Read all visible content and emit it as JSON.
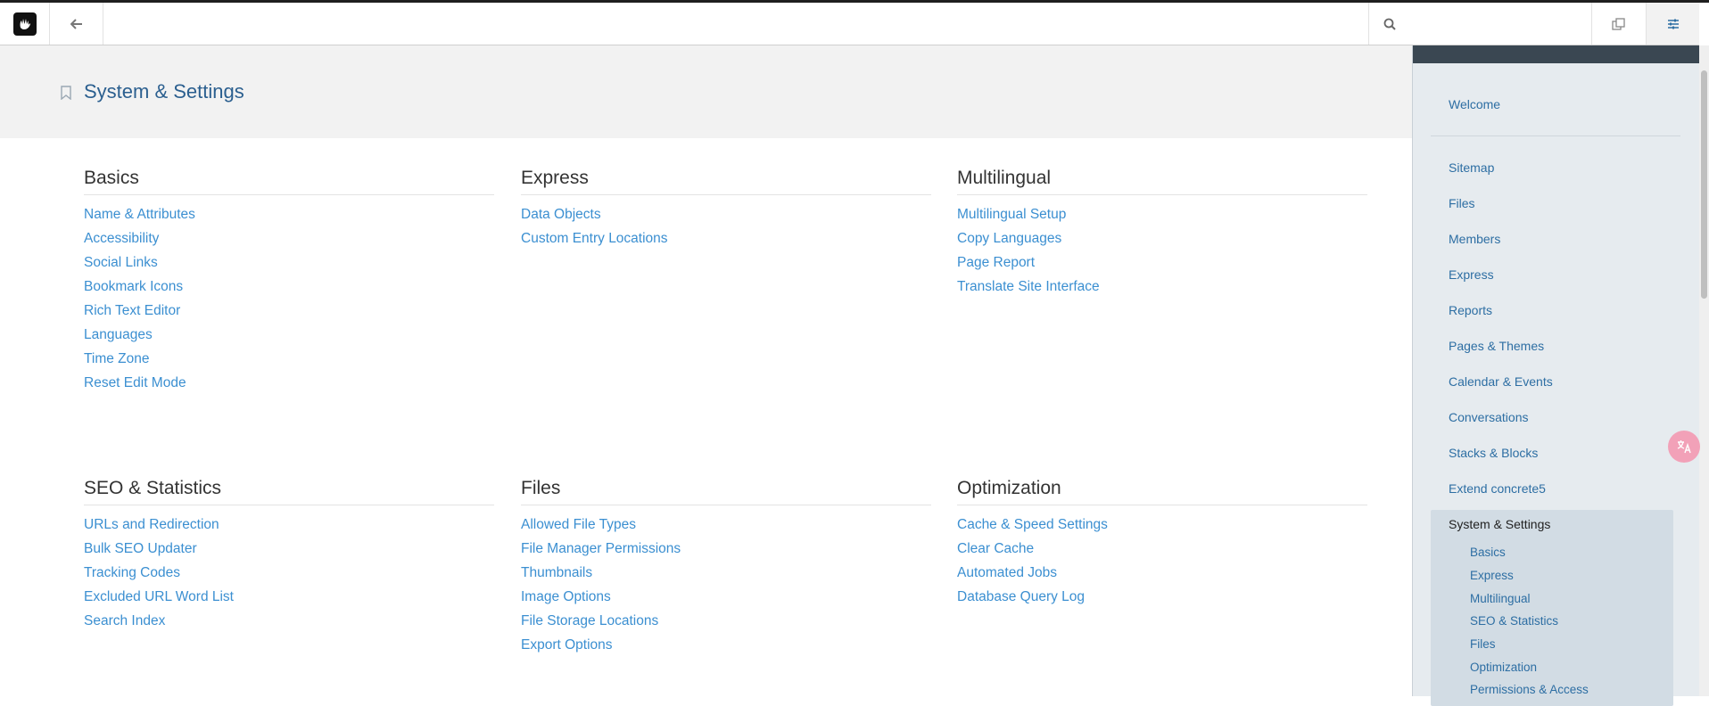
{
  "header": {
    "title": "System & Settings"
  },
  "search": {
    "placeholder": ""
  },
  "sections": [
    {
      "title": "Basics",
      "links": [
        "Name & Attributes",
        "Accessibility",
        "Social Links",
        "Bookmark Icons",
        "Rich Text Editor",
        "Languages",
        "Time Zone",
        "Reset Edit Mode"
      ]
    },
    {
      "title": "Express",
      "links": [
        "Data Objects",
        "Custom Entry Locations"
      ]
    },
    {
      "title": "Multilingual",
      "links": [
        "Multilingual Setup",
        "Copy Languages",
        "Page Report",
        "Translate Site Interface"
      ]
    },
    {
      "title": "SEO & Statistics",
      "links": [
        "URLs and Redirection",
        "Bulk SEO Updater",
        "Tracking Codes",
        "Excluded URL Word List",
        "Search Index"
      ]
    },
    {
      "title": "Files",
      "links": [
        "Allowed File Types",
        "File Manager Permissions",
        "Thumbnails",
        "Image Options",
        "File Storage Locations",
        "Export Options"
      ]
    },
    {
      "title": "Optimization",
      "links": [
        "Cache & Speed Settings",
        "Clear Cache",
        "Automated Jobs",
        "Database Query Log"
      ]
    }
  ],
  "sidebar": {
    "welcome": "Welcome",
    "items": [
      "Sitemap",
      "Files",
      "Members",
      "Express",
      "Reports",
      "Pages & Themes",
      "Calendar & Events",
      "Conversations",
      "Stacks & Blocks",
      "Extend concrete5"
    ],
    "active": "System & Settings",
    "subitems": [
      "Basics",
      "Express",
      "Multilingual",
      "SEO & Statistics",
      "Files",
      "Optimization",
      "Permissions & Access"
    ]
  },
  "colors": {
    "link": "#3b8fd1",
    "title": "#2b5f8f",
    "sidebar_bg": "#e6ebef"
  },
  "icons": {
    "logo": "concrete5-logo-icon",
    "back": "arrow-left-icon",
    "search": "search-icon",
    "tabs": "intelligent-search-icon",
    "panel": "sliders-icon",
    "bookmark": "bookmark-icon",
    "floating": "translate-icon"
  }
}
